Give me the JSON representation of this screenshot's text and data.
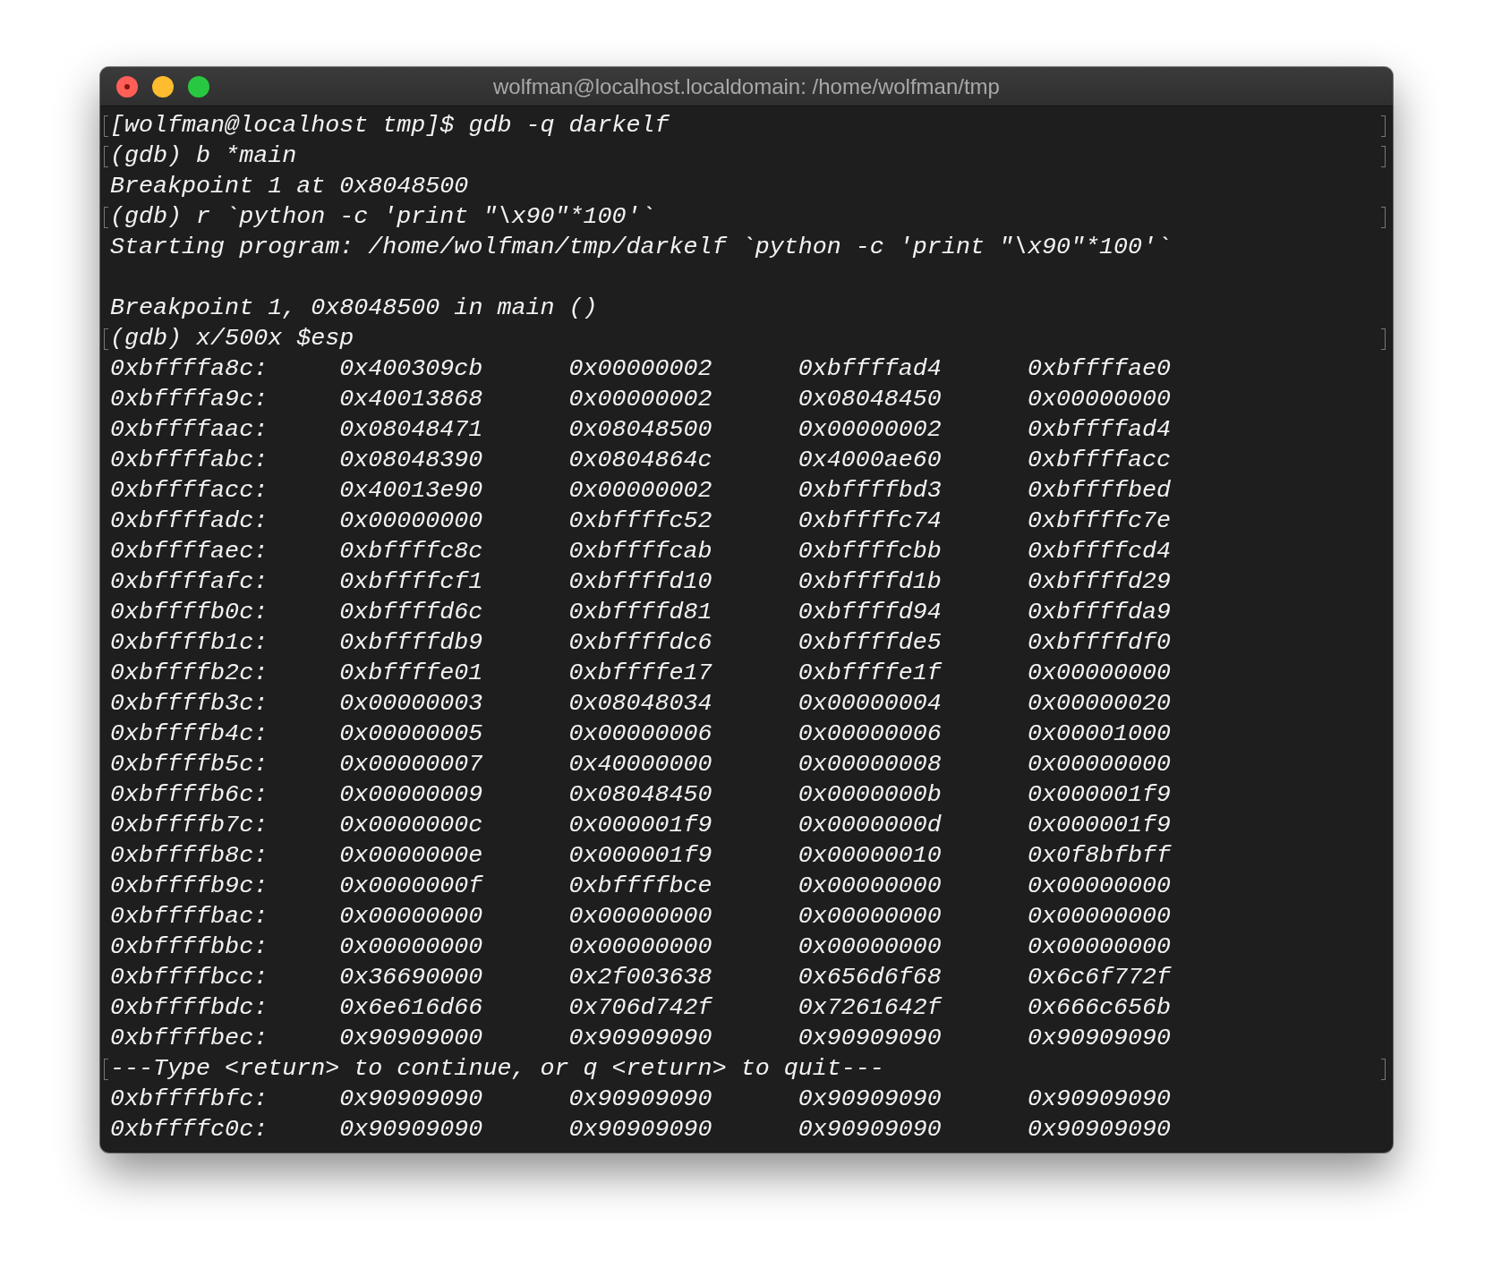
{
  "window": {
    "title": "wolfman@localhost.localdomain: /home/wolfman/tmp"
  },
  "lines": [
    {
      "kind": "text",
      "text": "[wolfman@localhost tmp]$ gdb -q darkelf",
      "marked": true
    },
    {
      "kind": "text",
      "text": "(gdb) b *main",
      "marked": true
    },
    {
      "kind": "text",
      "text": "Breakpoint 1 at 0x8048500",
      "marked": false
    },
    {
      "kind": "text",
      "text": "(gdb) r `python -c 'print \"\\x90\"*100'`",
      "marked": true
    },
    {
      "kind": "text",
      "text": "Starting program: /home/wolfman/tmp/darkelf `python -c 'print \"\\x90\"*100'`",
      "marked": false
    },
    {
      "kind": "blank",
      "marked": false
    },
    {
      "kind": "text",
      "text": "Breakpoint 1, 0x8048500 in main ()",
      "marked": false
    },
    {
      "kind": "text",
      "text": "(gdb) x/500x $esp",
      "marked": true
    },
    {
      "kind": "memory",
      "address": "0xbffffa8c:",
      "values": [
        "0x400309cb",
        "0x00000002",
        "0xbffffad4",
        "0xbffffae0"
      ]
    },
    {
      "kind": "memory",
      "address": "0xbffffa9c:",
      "values": [
        "0x40013868",
        "0x00000002",
        "0x08048450",
        "0x00000000"
      ]
    },
    {
      "kind": "memory",
      "address": "0xbffffaac:",
      "values": [
        "0x08048471",
        "0x08048500",
        "0x00000002",
        "0xbffffad4"
      ]
    },
    {
      "kind": "memory",
      "address": "0xbffffabc:",
      "values": [
        "0x08048390",
        "0x0804864c",
        "0x4000ae60",
        "0xbffffacc"
      ]
    },
    {
      "kind": "memory",
      "address": "0xbffffacc:",
      "values": [
        "0x40013e90",
        "0x00000002",
        "0xbffffbd3",
        "0xbffffbed"
      ]
    },
    {
      "kind": "memory",
      "address": "0xbffffadc:",
      "values": [
        "0x00000000",
        "0xbffffc52",
        "0xbffffc74",
        "0xbffffc7e"
      ]
    },
    {
      "kind": "memory",
      "address": "0xbffffaec:",
      "values": [
        "0xbffffc8c",
        "0xbffffcab",
        "0xbffffcbb",
        "0xbffffcd4"
      ]
    },
    {
      "kind": "memory",
      "address": "0xbffffafc:",
      "values": [
        "0xbffffcf1",
        "0xbffffd10",
        "0xbffffd1b",
        "0xbffffd29"
      ]
    },
    {
      "kind": "memory",
      "address": "0xbffffb0c:",
      "values": [
        "0xbffffd6c",
        "0xbffffd81",
        "0xbffffd94",
        "0xbffffda9"
      ]
    },
    {
      "kind": "memory",
      "address": "0xbffffb1c:",
      "values": [
        "0xbffffdb9",
        "0xbffffdc6",
        "0xbffffde5",
        "0xbffffdf0"
      ]
    },
    {
      "kind": "memory",
      "address": "0xbffffb2c:",
      "values": [
        "0xbffffe01",
        "0xbffffe17",
        "0xbffffe1f",
        "0x00000000"
      ]
    },
    {
      "kind": "memory",
      "address": "0xbffffb3c:",
      "values": [
        "0x00000003",
        "0x08048034",
        "0x00000004",
        "0x00000020"
      ]
    },
    {
      "kind": "memory",
      "address": "0xbffffb4c:",
      "values": [
        "0x00000005",
        "0x00000006",
        "0x00000006",
        "0x00001000"
      ]
    },
    {
      "kind": "memory",
      "address": "0xbffffb5c:",
      "values": [
        "0x00000007",
        "0x40000000",
        "0x00000008",
        "0x00000000"
      ]
    },
    {
      "kind": "memory",
      "address": "0xbffffb6c:",
      "values": [
        "0x00000009",
        "0x08048450",
        "0x0000000b",
        "0x000001f9"
      ]
    },
    {
      "kind": "memory",
      "address": "0xbffffb7c:",
      "values": [
        "0x0000000c",
        "0x000001f9",
        "0x0000000d",
        "0x000001f9"
      ]
    },
    {
      "kind": "memory",
      "address": "0xbffffb8c:",
      "values": [
        "0x0000000e",
        "0x000001f9",
        "0x00000010",
        "0x0f8bfbff"
      ]
    },
    {
      "kind": "memory",
      "address": "0xbffffb9c:",
      "values": [
        "0x0000000f",
        "0xbffffbce",
        "0x00000000",
        "0x00000000"
      ]
    },
    {
      "kind": "memory",
      "address": "0xbffffbac:",
      "values": [
        "0x00000000",
        "0x00000000",
        "0x00000000",
        "0x00000000"
      ]
    },
    {
      "kind": "memory",
      "address": "0xbffffbbc:",
      "values": [
        "0x00000000",
        "0x00000000",
        "0x00000000",
        "0x00000000"
      ]
    },
    {
      "kind": "memory",
      "address": "0xbffffbcc:",
      "values": [
        "0x36690000",
        "0x2f003638",
        "0x656d6f68",
        "0x6c6f772f"
      ]
    },
    {
      "kind": "memory",
      "address": "0xbffffbdc:",
      "values": [
        "0x6e616d66",
        "0x706d742f",
        "0x7261642f",
        "0x666c656b"
      ]
    },
    {
      "kind": "memory",
      "address": "0xbffffbec:",
      "values": [
        "0x90909000",
        "0x90909090",
        "0x90909090",
        "0x90909090"
      ]
    },
    {
      "kind": "text",
      "text": "---Type <return> to continue, or q <return> to quit---",
      "marked": true
    },
    {
      "kind": "memory",
      "address": "0xbffffbfc:",
      "values": [
        "0x90909090",
        "0x90909090",
        "0x90909090",
        "0x90909090"
      ]
    },
    {
      "kind": "memory",
      "address": "0xbffffc0c:",
      "values": [
        "0x90909090",
        "0x90909090",
        "0x90909090",
        "0x90909090"
      ]
    }
  ]
}
